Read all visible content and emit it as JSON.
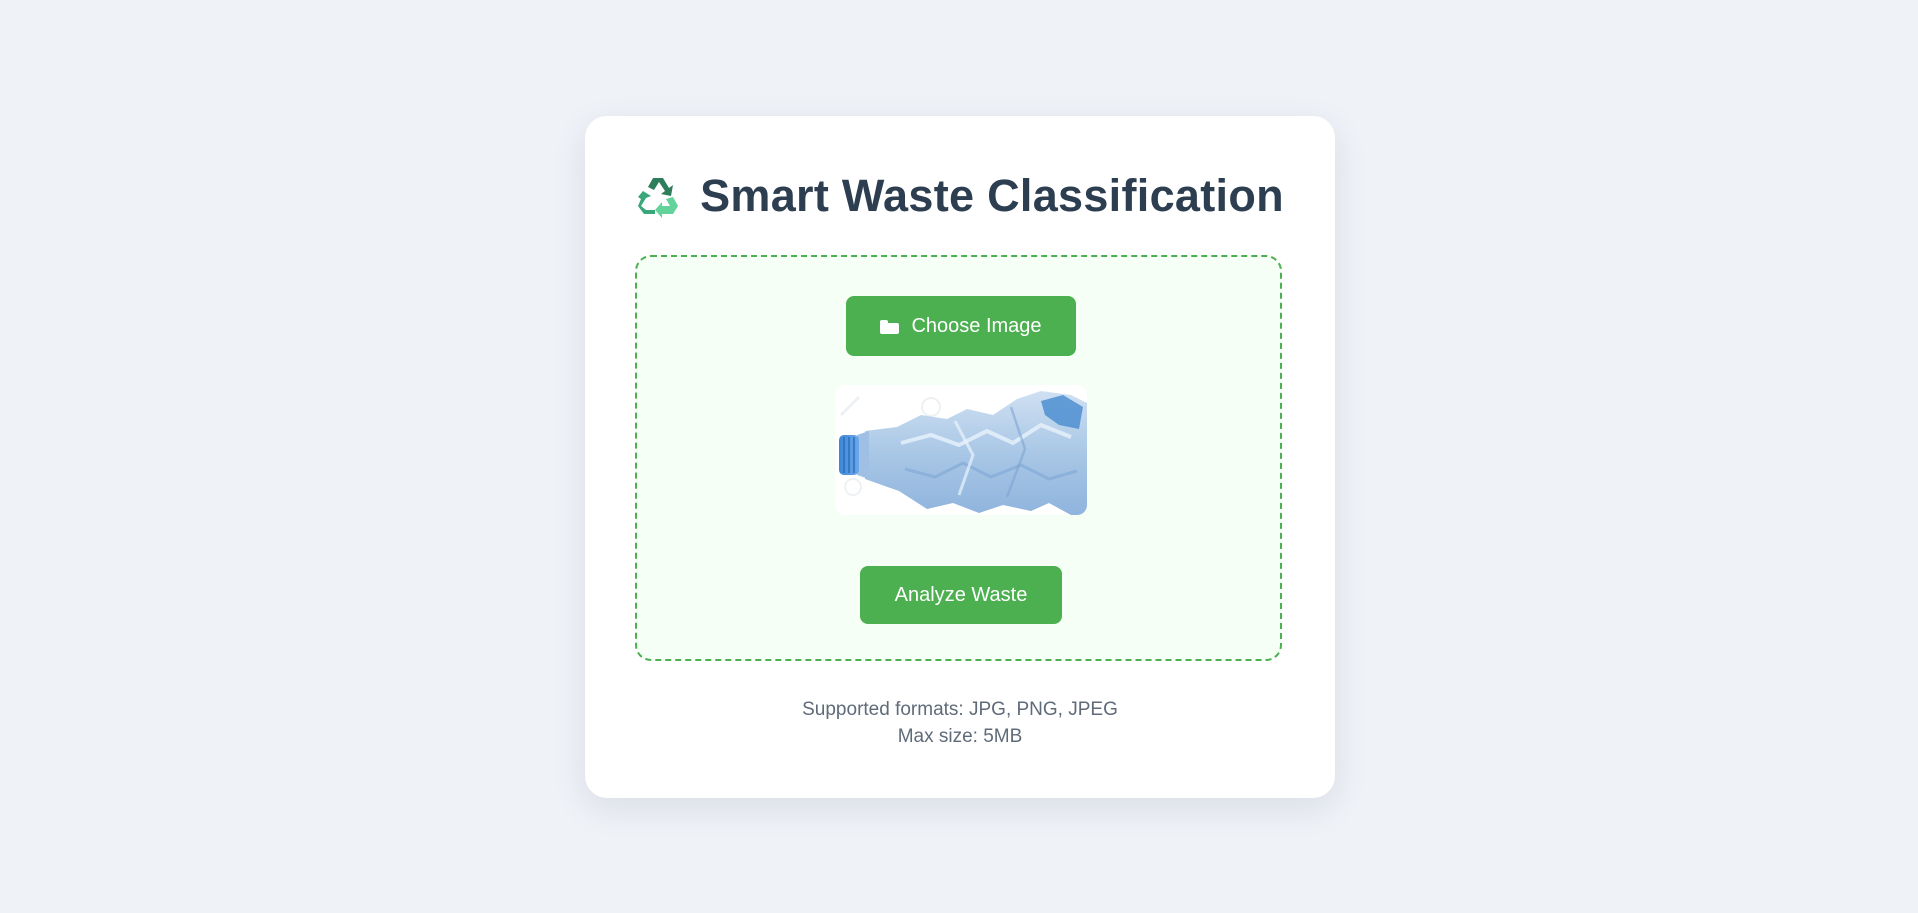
{
  "header": {
    "icon": "recycle-icon",
    "title": "Smart Waste Classification"
  },
  "upload": {
    "choose_button": {
      "icon": "folder-icon",
      "label": "Choose Image"
    },
    "preview": {
      "subject": "crushed plastic bottle"
    },
    "analyze_button": {
      "label": "Analyze Waste"
    }
  },
  "info": {
    "formats": "Supported formats: JPG, PNG, JPEG",
    "max_size": "Max size: 5MB"
  },
  "colors": {
    "background": "#eff2f7",
    "card": "#ffffff",
    "accent": "#4caf50",
    "zone_background": "#f6fff6",
    "title_text": "#2c3e50",
    "muted_text": "#5f6b78"
  }
}
